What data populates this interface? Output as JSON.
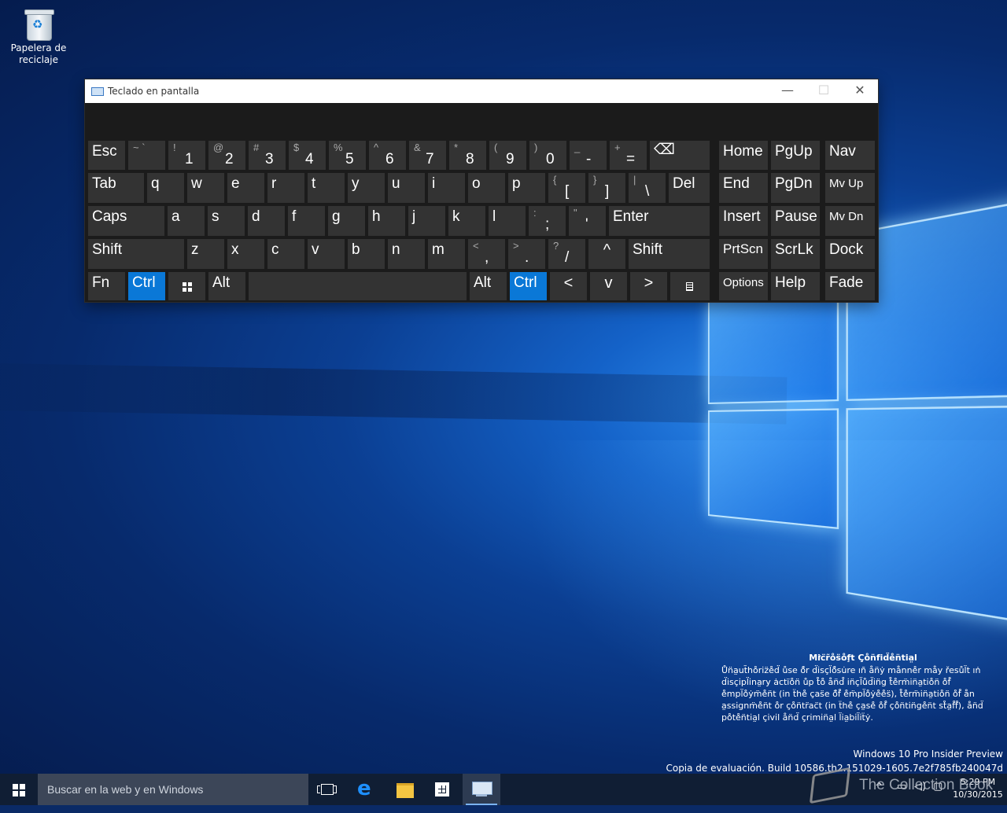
{
  "desktop": {
    "recycle_bin_label": "Papelera de reciclaje",
    "confidential": {
      "title": "Mi̛c̈r̃o̊s̈o̊f̧t Ç̧o̊n̈fi̇d̈e̊n̈ti̇a̤l",
      "body": "Ůn̈a̤ut̃ho̊ri̇z̈e̊d̈ ůse ö̊r d̈i̇sçl̈ö̊su̇re ıñ ån̈ẏ månne̊r måy řesůl̈t ıṅ d̈i̇sçi̇pl̈i̇na̤ry ȧctı̈o̊n̈ ůp t̊o̊ ån̈d̊ i̇n̈çl̈ůd̈i̇n̈g t̊e̊rm̈i̇n̈a̤ti̇o̊n̈ o̊f̊ e̊mpl̈o̊ẏm̈e̊n̈t (i̇n ẗhe̊ ças̈e ö̊f̊ e̊m̈pl̈o̊ẏe̊e̊s̈), t̊e̊rm̈i̇n̈a̤ti̇o̊n̈ o̊f̊ ån a̤ssi̇gnm̈e̊n̈t o̊r ço̊n̈tr̈ac̈t (i̇n ẗhe̊ ça̤se̊ o̊f̊ ço̊n̈ti̇n̈ge̊n̈t st̊a̤f̊f̊), ån̈d̈ po̊te̊n̈ti̇a̤l çi̇vi̇l ån̈d̈ çri̇mi̇n̈a̤l l̈i̇a̤bi̇l̈i̇ẗẏ."
    },
    "edition_line1": "Windows 10 Pro Insider Preview",
    "edition_line2": "Copia de evaluación. Build 10586.th2.151029-1605.7e2f785fb240047d"
  },
  "osk": {
    "title": "Teclado en pantalla",
    "minimize": "—",
    "maximize": "☐",
    "close": "✕",
    "keys": {
      "esc": "Esc",
      "grave_sym": "~ `",
      "n1_sym": "!",
      "n1": "1",
      "n2_sym": "@",
      "n2": "2",
      "n3_sym": "#",
      "n3": "3",
      "n4_sym": "$",
      "n4": "4",
      "n5_sym": "%",
      "n5": "5",
      "n6_sym": "^",
      "n6": "6",
      "n7_sym": "&",
      "n7": "7",
      "n8_sym": "*",
      "n8": "8",
      "n9_sym": "(",
      "n9": "9",
      "n0_sym": ")",
      "n0": "0",
      "minus_sym": "_",
      "minus": "-",
      "equals_sym": "+",
      "equals": "=",
      "backspace": "⌫",
      "home": "Home",
      "pgup": "PgUp",
      "nav": "Nav",
      "tab": "Tab",
      "q": "q",
      "w": "w",
      "e": "e",
      "r": "r",
      "t": "t",
      "y": "y",
      "u": "u",
      "i": "i",
      "o": "o",
      "p": "p",
      "lbracket_sym": "{",
      "lbracket": "[",
      "rbracket_sym": "}",
      "rbracket": "]",
      "backslash_sym": "|",
      "backslash": "\\",
      "del": "Del",
      "end": "End",
      "pgdn": "PgDn",
      "mvup": "Mv Up",
      "caps": "Caps",
      "a": "a",
      "s": "s",
      "d": "d",
      "f": "f",
      "g": "g",
      "h": "h",
      "j": "j",
      "k": "k",
      "l": "l",
      "semicolon_sym": ":",
      "semicolon": ";",
      "quote_sym": "\"",
      "quote": "'",
      "enter": "Enter",
      "insert": "Insert",
      "pause": "Pause",
      "mvdn": "Mv Dn",
      "shift": "Shift",
      "z": "z",
      "x": "x",
      "c": "c",
      "v": "v",
      "b": "b",
      "n": "n",
      "m": "m",
      "comma_sym": "<",
      "comma": ",",
      "period_sym": ">",
      "period": ".",
      "slash_sym": "?",
      "slash": "/",
      "up": "^",
      "shift_r": "Shift",
      "prtscn": "PrtScn",
      "scrlk": "ScrLk",
      "dock": "Dock",
      "fn": "Fn",
      "ctrl": "Ctrl",
      "alt": "Alt",
      "alt_r": "Alt",
      "ctrl_r": "Ctrl",
      "left": "<",
      "down": "v",
      "right": ">",
      "options": "Options",
      "help": "Help",
      "fade": "Fade"
    }
  },
  "taskbar": {
    "search_placeholder": "Buscar en la web y en Windows",
    "time": "5:29 PM",
    "date": "10/30/2015",
    "watermark": "The Collection Book"
  }
}
